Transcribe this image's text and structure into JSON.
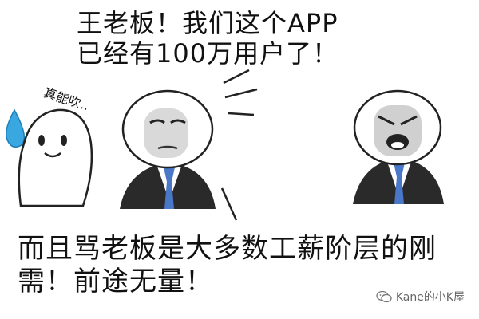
{
  "top_caption": {
    "line1": "王老板！我们这个APP",
    "line2": "已经有100万用户了！"
  },
  "side_remark": "真能吹..",
  "bottom_caption": {
    "line1": "而且骂老板是大多数工薪阶层的刚",
    "line2": "需！前途无量！"
  },
  "watermark": "Kane的小K屋",
  "colors": {
    "tie_blue": "#4a78c8",
    "sweat_blue": "#3aa8e0",
    "suit": "#2a2a2a"
  }
}
